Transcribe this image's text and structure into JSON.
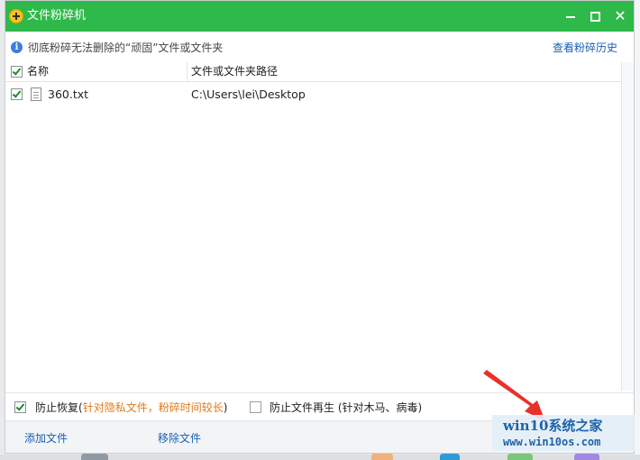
{
  "window": {
    "title": "文件粉碎机"
  },
  "info": {
    "text": "彻底粉碎无法删除的“顽固”文件或文件夹",
    "history_link": "查看粉碎历史"
  },
  "table": {
    "columns": [
      "名称",
      "文件或文件夹路径"
    ],
    "rows": [
      {
        "name": "360.txt",
        "path": "C:\\Users\\lei\\Desktop",
        "checked": true
      }
    ]
  },
  "options": {
    "prevent_recovery": {
      "label": "防止恢复",
      "open": "(",
      "note": "针对隐私文件，粉碎时间较长",
      "close": ")",
      "checked": true
    },
    "prevent_regen": {
      "label": "防止文件再生",
      "note": "(针对木马、病毒)",
      "checked": false
    }
  },
  "footer": {
    "add_file": "添加文件",
    "remove_file": "移除文件"
  },
  "watermark": {
    "title": "win10系统之家",
    "url": "www.win10os.com"
  },
  "colors": {
    "titlebar": "#2fb94a",
    "link": "#1a5fb4",
    "note": "#e07b1a",
    "arrow": "#e8312b",
    "watermark": "#1f63a8"
  }
}
